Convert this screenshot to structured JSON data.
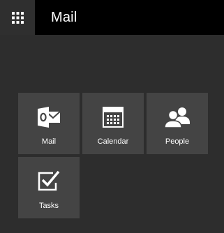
{
  "header": {
    "title": "Mail",
    "app_launcher_icon": "waffle-grid-icon"
  },
  "tiles": [
    {
      "label": "Mail",
      "icon": "outlook-mail-icon"
    },
    {
      "label": "Calendar",
      "icon": "calendar-icon"
    },
    {
      "label": "People",
      "icon": "people-icon"
    },
    {
      "label": "Tasks",
      "icon": "tasks-checkbox-icon"
    }
  ],
  "colors": {
    "header_bg": "#000000",
    "launcher_bg": "#2f2f2f",
    "page_bg": "#2d2d2d",
    "tile_bg": "#444444",
    "text": "#ffffff"
  }
}
